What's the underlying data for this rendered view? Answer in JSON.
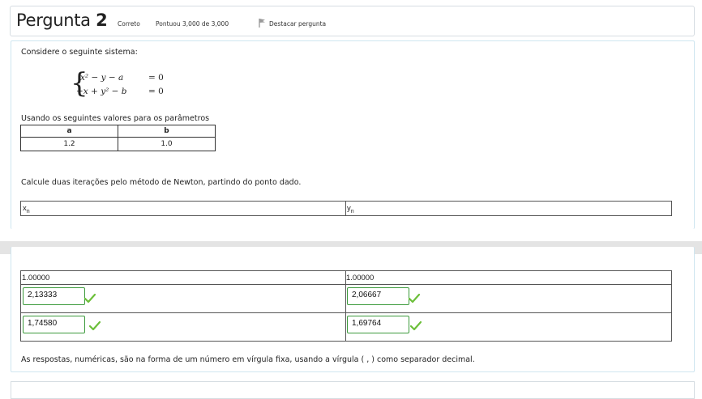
{
  "header": {
    "title_prefix": "Pergunta",
    "number": "2",
    "status": "Correto",
    "score": "Pontuou 3,000 de 3,000",
    "flag_label": "Destacar pergunta"
  },
  "question": {
    "intro": "Considere o seguinte sistema:",
    "eq1_lhs": "x² − y − a",
    "eq1_rhs": "= 0",
    "eq2_lhs": "−x + y² − b",
    "eq2_rhs": "= 0",
    "params_intro": "Usando os seguintes valores para os parâmetros",
    "params_table": {
      "headers": [
        "a",
        "b"
      ],
      "values": [
        "1.2",
        "1.0"
      ]
    },
    "instruction": "Calcule duas iterações pelo método de Newton, partindo do ponto dado.",
    "columns": {
      "x_label": "x",
      "x_sub": "n",
      "y_label": "y",
      "y_sub": "n"
    },
    "start": {
      "x": "1.00000",
      "y": "1.00000"
    },
    "answers": [
      {
        "x": "2,13333",
        "y": "2,06667"
      },
      {
        "x": "1,74580",
        "y": "1,69764"
      }
    ],
    "note": "As respostas, numéricas, são na forma de um número em vírgula fixa, usando a vírgula ( , ) como separador decimal."
  },
  "icons": {
    "flag": "flag-icon",
    "check": "check-icon"
  },
  "colors": {
    "correct": "#6cbf3a",
    "border_green": "#3c9a3c",
    "panel_border": "#cfe6f0"
  }
}
